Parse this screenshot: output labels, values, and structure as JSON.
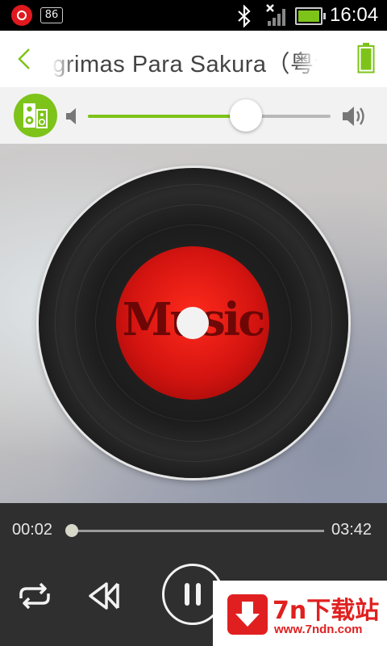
{
  "status_bar": {
    "notification_count": "86",
    "time": "16:04"
  },
  "header": {
    "title": "Lágrimas Para Sakura（粤语版）"
  },
  "volume": {
    "level": 0.65
  },
  "album_art": {
    "label_text": "Music"
  },
  "playback": {
    "elapsed": "00:02",
    "total": "03:42",
    "progress": 0.01
  },
  "watermark": {
    "name": "7n下载站",
    "url": "www.7ndn.com"
  },
  "colors": {
    "accent": "#7ec31a",
    "watermark_red": "#e02020"
  }
}
